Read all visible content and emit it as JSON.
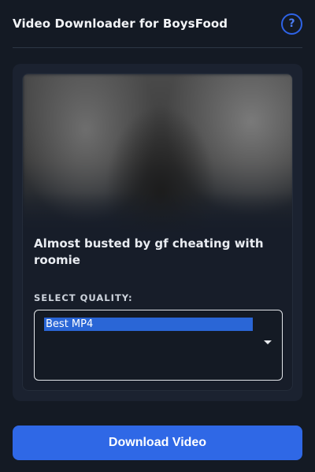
{
  "header": {
    "title": "Video Downloader for BoysFood",
    "help_label": "?"
  },
  "video": {
    "title": "Almost busted by gf cheating with roomie"
  },
  "quality": {
    "label": "SELECT QUALITY:",
    "selected": "Best MP4"
  },
  "actions": {
    "download_label": "Download Video"
  },
  "colors": {
    "background": "#141a24",
    "card": "#1b2230",
    "accent": "#2f68e6",
    "selection": "#2a66d6"
  }
}
